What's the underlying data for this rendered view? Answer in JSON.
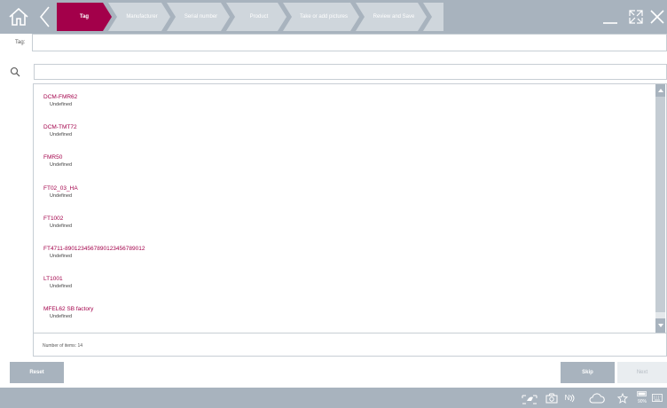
{
  "toolbar": {
    "steps": [
      {
        "label": "Tag",
        "active": true
      },
      {
        "label": "Manufacturer",
        "active": false
      },
      {
        "label": "Serial number",
        "active": false
      },
      {
        "label": "Product",
        "active": false
      },
      {
        "label": "Take or add pictures",
        "active": false
      },
      {
        "label": "Review and Save",
        "active": false
      }
    ],
    "icons": {
      "home": "home-icon",
      "back": "chevron-left-icon",
      "minimize": "minimize-icon",
      "maximize": "expand-icon",
      "close": "close-icon"
    }
  },
  "tag_field": {
    "label": "Tag:",
    "value": ""
  },
  "search": {
    "value": "",
    "icon": "search-icon"
  },
  "list": {
    "items": [
      {
        "name": "DCM-FMR62",
        "status": "Undefined"
      },
      {
        "name": "DCM-TMT72",
        "status": "Undefined"
      },
      {
        "name": "FMR50",
        "status": "Undefined"
      },
      {
        "name": "FT02_03_HA",
        "status": "Undefined"
      },
      {
        "name": "FT1002",
        "status": "Undefined"
      },
      {
        "name": "FT4711-890123456789012345678901​2",
        "status": "Undefined"
      },
      {
        "name": "LT1001",
        "status": "Undefined"
      },
      {
        "name": "MFEL62 SB factory",
        "status": "Undefined"
      }
    ],
    "count_label": "Number of items: 14"
  },
  "buttons": {
    "reset": "Reset",
    "skip": "Skip",
    "next": "Next"
  },
  "statusbar": {
    "nfc_label": "N",
    "battery_label": "90%",
    "icons": [
      "hand-scan-icon",
      "camera-icon",
      "nfc-icon",
      "cloud-icon",
      "star-icon",
      "battery-icon"
    ]
  },
  "colors": {
    "accent": "#a3004a",
    "bar": "#a8b3be",
    "step_inactive": "#cfd6dc"
  }
}
